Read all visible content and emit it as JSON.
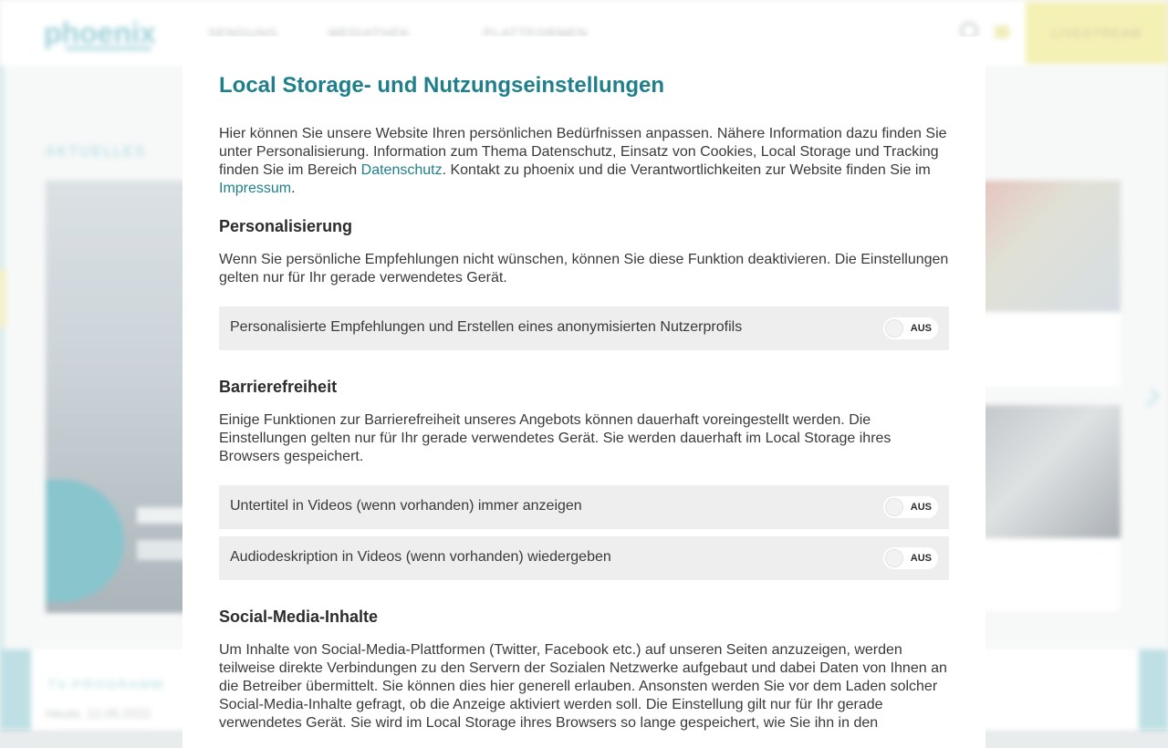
{
  "background": {
    "logo": "phoenix",
    "nav": [
      "SENDUNG",
      "MEDIATHEK",
      "PLATTFORMEN"
    ],
    "live_button": "LIVESTREAM",
    "section_title": "AKTUELLES",
    "bottom_title": "TV-PROGRAMM",
    "bottom_sub": "Heute, 12.05.2022"
  },
  "modal": {
    "title": "Local Storage- und Nutzungseinstellungen",
    "intro": {
      "text_1": "Hier können Sie unsere Website Ihren persönlichen Bedürfnissen anpassen. Nähere Information dazu finden Sie unter Personalisierung. Information zum Thema Datenschutz, Einsatz von Cookies, Local Storage und Tracking finden Sie im Bereich ",
      "link_datenschutz": "Datenschutz",
      "text_2": ". Kontakt zu phoenix und die Verantwortlichkeiten zur Website finden Sie im ",
      "link_impressum": "Impressum",
      "text_3": "."
    },
    "personalisierung": {
      "heading": "Personalisierung",
      "description": "Wenn Sie persönliche Empfehlungen nicht wünschen, können Sie diese Funktion deaktivieren. Die Einstellungen gelten nur für Ihr gerade verwendetes Gerät.",
      "settings": [
        {
          "label": "Personalisierte Empfehlungen und Erstellen eines anonymisierten Nutzerprofils",
          "state": "AUS"
        }
      ]
    },
    "barrierefreiheit": {
      "heading": "Barrierefreiheit",
      "description": "Einige Funktionen zur Barrierefreiheit unseres Angebots können dauerhaft voreingestellt werden. Die Einstellungen gelten nur für Ihr gerade verwendetes Gerät. Sie werden dauerhaft im Local Storage ihres Browsers gespeichert.",
      "settings": [
        {
          "label": "Untertitel in Videos (wenn vorhanden) immer anzeigen",
          "state": "AUS"
        },
        {
          "label": "Audiodeskription in Videos (wenn vorhanden) wiedergeben",
          "state": "AUS"
        }
      ]
    },
    "social_media": {
      "heading": "Social-Media-Inhalte",
      "description": "Um Inhalte von Social-Media-Plattformen (Twitter, Facebook etc.) auf unseren Seiten anzuzeigen, werden teilweise direkte Verbindungen zu den Servern der Sozialen Netzwerke aufgebaut und dabei Daten von Ihnen an die Betreiber übermittelt. Sie können dies hier generell erlauben. Ansonsten werden Sie vor dem Laden solcher Social-Media-Inhalte gefragt, ob die Anzeige aktiviert werden soll. Die Einstellung gilt nur für Ihr gerade verwendetes Gerät. Sie wird im Local Storage ihres Browsers so lange gespeichert, wie Sie ihn in den"
    }
  }
}
